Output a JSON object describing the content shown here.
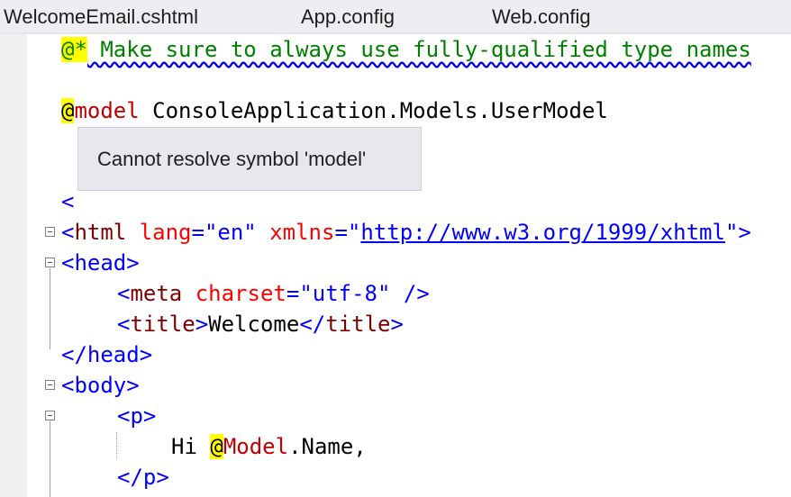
{
  "tabs": [
    {
      "label": "WelcomeEmail.cshtml"
    },
    {
      "label": "App.config"
    },
    {
      "label": "Web.config"
    }
  ],
  "code": {
    "comment_marker": "@*",
    "comment_text": " Make sure to always use fully-qualified type names",
    "model_at": "@",
    "model_kw": "model",
    "model_type": " ConsoleApplication.Models.UserModel",
    "partial_lt": "<",
    "html_open_lt": "<",
    "html_tag": "html",
    "html_attr1": "lang",
    "html_eq1": "=",
    "html_val1": "\"en\"",
    "html_attr2": "xmlns",
    "html_eq2": "=",
    "html_q1": "\"",
    "html_url": "http://www.w3.org/1999/xhtml",
    "html_q2": "\"",
    "html_close": ">",
    "head_open": "<head>",
    "meta_lt": "<",
    "meta_tag": "meta",
    "meta_attr": "charset",
    "meta_eq": "=",
    "meta_val": "\"utf-8\"",
    "meta_end": " />",
    "title_open_lt": "<",
    "title_tag": "title",
    "title_open_gt": ">",
    "title_text": "Welcome",
    "title_close_lt": "</",
    "title_close_tag": "title",
    "title_close_gt": ">",
    "head_close": "</head>",
    "body_open": "<body>",
    "p_open": "<p>",
    "hi_text": "Hi ",
    "model_at2": "@",
    "model_ref": "Model",
    "dot": ".",
    "name_prop": "Name",
    "comma": ",",
    "p_close": "</p>"
  },
  "tooltip": {
    "message": "Cannot resolve symbol 'model'"
  }
}
